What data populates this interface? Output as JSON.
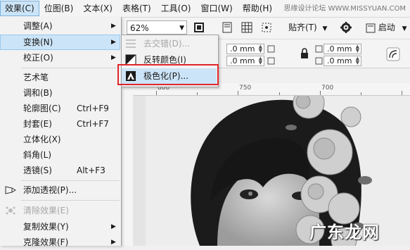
{
  "menubar": {
    "items": [
      "效果(C)",
      "位图(B)",
      "文本(X)",
      "表格(T)",
      "工具(O)",
      "窗口(W)",
      "帮助(H)"
    ],
    "watermark": "思缘设计论坛 WWW.MISSYUAN.COM"
  },
  "toolbar": {
    "zoom_value": "62%",
    "snap_label": "贴齐(T)",
    "launch_label": "启动"
  },
  "propbar": {
    "field1": ".0 mm",
    "field2": ".0 mm",
    "field3": ".0 mm",
    "field4": ".0 mm"
  },
  "ruler": {
    "labels": [
      "800",
      "750",
      "700"
    ]
  },
  "effects_menu": {
    "items": [
      {
        "label": "调整(A)",
        "shortcut": "",
        "submenu": true
      },
      {
        "label": "变换(N)",
        "shortcut": "",
        "submenu": true
      },
      {
        "label": "校正(O)",
        "shortcut": "",
        "submenu": true
      },
      {
        "label": "艺术笔",
        "shortcut": "",
        "submenu": false
      },
      {
        "label": "调和(B)",
        "shortcut": "",
        "submenu": false
      },
      {
        "label": "轮廓图(C)",
        "shortcut": "Ctrl+F9",
        "submenu": false
      },
      {
        "label": "封套(E)",
        "shortcut": "Ctrl+F7",
        "submenu": false
      },
      {
        "label": "立体化(X)",
        "shortcut": "",
        "submenu": false
      },
      {
        "label": "斜角(L)",
        "shortcut": "",
        "submenu": false
      },
      {
        "label": "透镜(S)",
        "shortcut": "Alt+F3",
        "submenu": false
      },
      {
        "label": "添加透视(P)...",
        "shortcut": "",
        "submenu": false
      },
      {
        "label": "清除效果(E)",
        "shortcut": "",
        "submenu": false
      },
      {
        "label": "复制效果(Y)",
        "shortcut": "",
        "submenu": true
      },
      {
        "label": "克隆效果(F)",
        "shortcut": "",
        "submenu": true
      }
    ]
  },
  "transform_submenu": {
    "items": [
      {
        "label": "去交错(D)...",
        "disabled": true
      },
      {
        "label": "反转颜色(I)",
        "disabled": false
      },
      {
        "label": "极色化(P)...",
        "disabled": false,
        "highlighted": true
      }
    ]
  },
  "canvas": {
    "watermark": "广东龙网"
  },
  "colors": {
    "highlight": "#cce4f7",
    "callout_border": "#e0262b"
  }
}
